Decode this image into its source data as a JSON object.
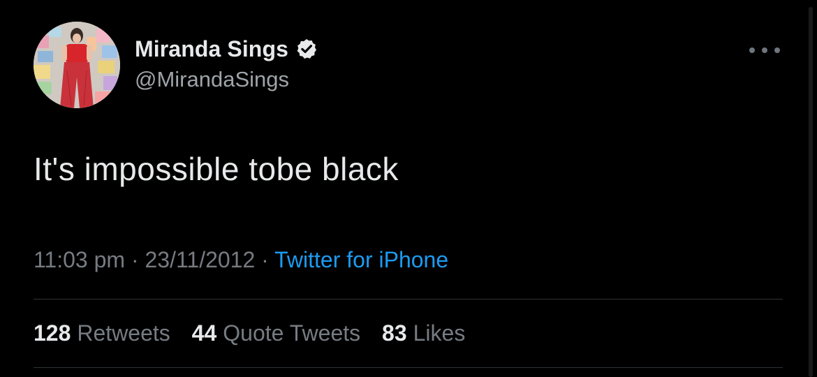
{
  "author": {
    "display_name": "Miranda Sings",
    "handle": "@MirandaSings",
    "verified": true
  },
  "tweet": {
    "text": "It's impossible tobe black",
    "time": "11:03 pm",
    "separator": "·",
    "date": "23/11/2012",
    "source": "Twitter for iPhone"
  },
  "stats": {
    "retweets": {
      "count": "128",
      "label": "Retweets"
    },
    "quote_tweets": {
      "count": "44",
      "label": "Quote Tweets"
    },
    "likes": {
      "count": "83",
      "label": "Likes"
    }
  },
  "colors": {
    "background": "#000000",
    "primary_text": "#e7e9ea",
    "secondary_text": "#767c82",
    "link": "#1d9bf0",
    "divider": "#2f3336"
  },
  "icons": {
    "verified": "verified-badge-icon",
    "more": "more-options-icon"
  }
}
